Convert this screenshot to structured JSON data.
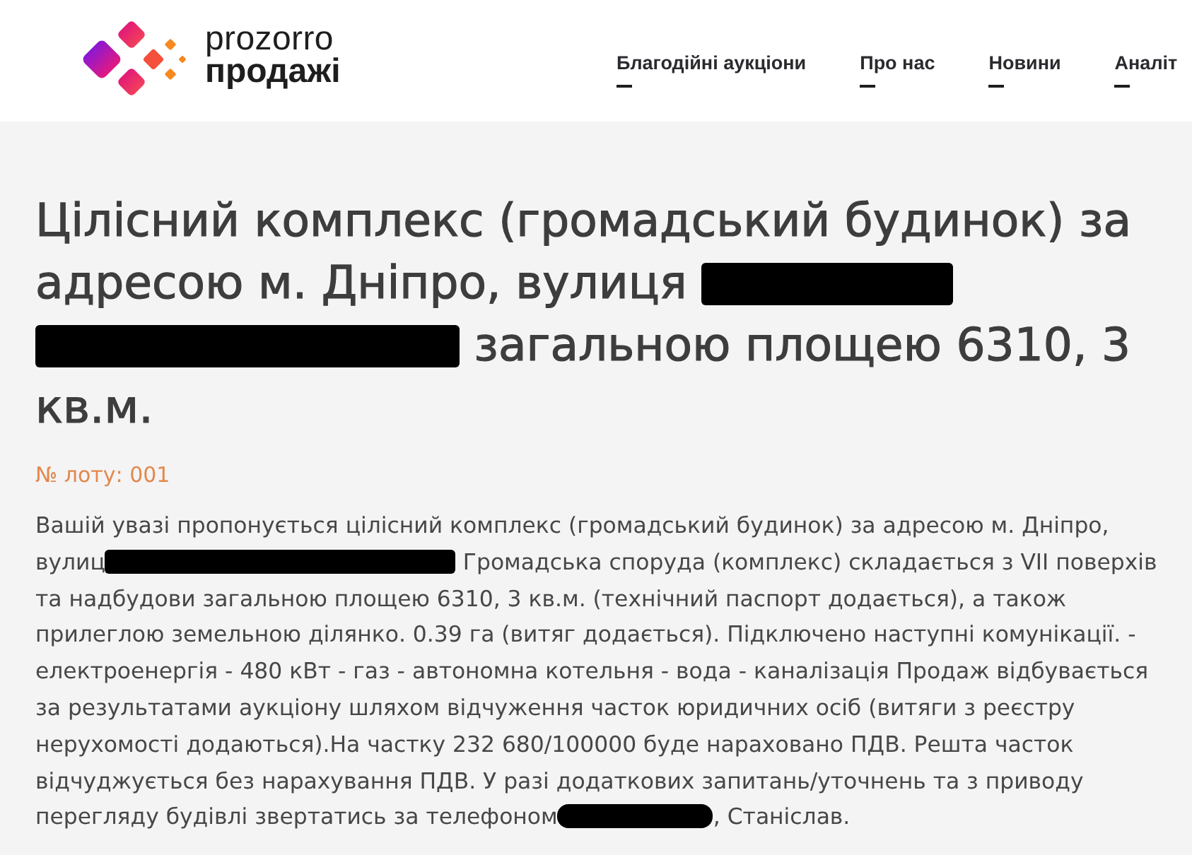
{
  "header": {
    "logo": {
      "line_1": "prozorro",
      "line_2": "продажі"
    },
    "nav": [
      "Благодійні аукціони",
      "Про нас",
      "Новини",
      "Аналіт"
    ]
  },
  "lot": {
    "title": [
      {
        "kind": "text",
        "text": "Цілісний комплекс (громадський будинок) за адресою м. Дніпро, вулиця "
      },
      {
        "kind": "redacted"
      },
      {
        "kind": "redacted"
      },
      {
        "kind": "text",
        "text": " загальною площею 6310, 3 кв.м."
      }
    ],
    "lot_number": "№ лоту: 001",
    "description": [
      {
        "kind": "text",
        "text": "Вашій увазі пропонується цілісний комплекс (громадський будинок) за адресою м. Дніпро, вулиц"
      },
      {
        "kind": "redacted"
      },
      {
        "kind": "text",
        "text": " Громадська споруда (комплекс) складається з VII поверхів та надбудови загальною площею 6310, 3 кв.м. (технічний паспорт додається), а також прилеглою земельною ділянко. 0.39 га (витяг додається). Підключено наступні комунікації. - електроенергія - 480 кВт - газ - автономна котельня - вода - каналізація Продаж відбувається за результатами аукціону шляхом відчуження часток юридичних осіб (витяги з реєстру нерухомості додаються).На частку 232 680/100000 буде нараховано ПДВ. Решта часток відчуджується без нарахування ПДВ. У разі додаткових запитань/уточнень та з приводу перегляду будівлі звертатись за телефоном"
      },
      {
        "kind": "redacted"
      },
      {
        "kind": "text",
        "text": ", Станіслав."
      }
    ]
  }
}
